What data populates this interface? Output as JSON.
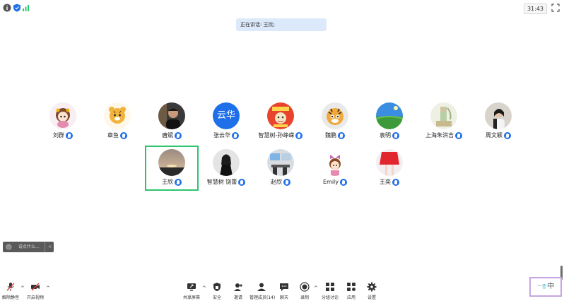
{
  "top": {
    "timer": "31:43"
  },
  "speaking": {
    "label": "正在讲话: 王欣;"
  },
  "participants": [
    {
      "name": "刘群",
      "avatar": "cartoon-girl"
    },
    {
      "name": "章鱼",
      "avatar": "cartoon-tiger"
    },
    {
      "name": "唐斌",
      "avatar": "photo-man"
    },
    {
      "name": "张云华",
      "avatar": "text-avatar",
      "avatar_text": "云华",
      "avatar_color": "#1e6fe8"
    },
    {
      "name": "智慧树-孙峥嵘",
      "avatar": "red-poster"
    },
    {
      "name": "魏鹏",
      "avatar": "cartoon-tiger-2"
    },
    {
      "name": "袁明",
      "avatar": "landscape"
    },
    {
      "name": "上海朱洪吉",
      "avatar": "painting"
    },
    {
      "name": "周文颖",
      "avatar": "photo-woman"
    },
    {
      "name": "王欣",
      "avatar": "sunset",
      "active": true
    },
    {
      "name": "智慧树 饶蕾",
      "avatar": "photo-woman-2"
    },
    {
      "name": "赵欣",
      "avatar": "office"
    },
    {
      "name": "Emily",
      "avatar": "cartoon-emily"
    },
    {
      "name": "王奕",
      "avatar": "red-skirt"
    }
  ],
  "chat": {
    "placeholder": "说点什么...",
    "toggle": "<"
  },
  "toolbar": {
    "unmute": "解除静音",
    "start_video": "开启视频",
    "share": "共享屏幕",
    "security": "安全",
    "invite": "邀请",
    "participants": "管理成员(14)",
    "chat": "聊天",
    "record": "录制",
    "breakout": "分组讨论",
    "apps": "应用",
    "settings": "设置"
  },
  "ime": {
    "label": "中"
  },
  "colors": {
    "accent": "#1e6fe8",
    "active_border": "#2dc46e",
    "speaking_bg": "#dbe9fb"
  }
}
